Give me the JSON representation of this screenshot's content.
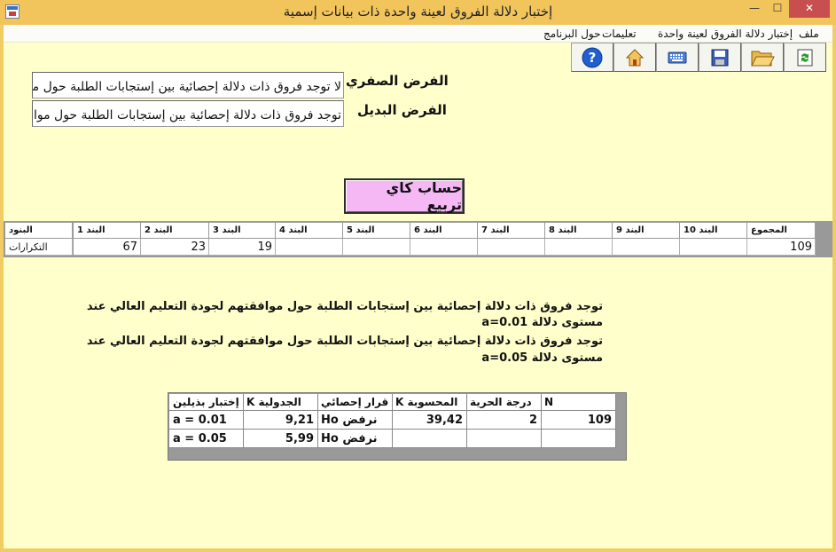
{
  "window": {
    "title": "إختبار دلالة الفروق لعينة واحدة ذات بيانات إسمية",
    "minimize_glyph": "—",
    "maximize_glyph": "☐",
    "close_glyph": "✕"
  },
  "menu": {
    "file": "ملف",
    "test": "إختبار دلالة الفروق لعينة واحدة",
    "instructions": "تعليمات",
    "about": "حول البرنامج"
  },
  "toolbar": {
    "icons": [
      "refresh-icon",
      "folder-open-icon",
      "save-icon",
      "keyboard-icon",
      "home-icon",
      "help-icon"
    ]
  },
  "hypotheses": {
    "null_label": "الفرض الصفري",
    "null_value": "لا توجد فروق ذات دلالة إحصائية بين إستجابات الطلبة حول موافقتهم",
    "alt_label": "الفرض البديل",
    "alt_value": "توجد فروق ذات دلالة إحصائية بين إستجابات الطلبة حول موافقتهم لـ"
  },
  "calculate_button": "حساب كاي تربيع",
  "frequency_grid": {
    "headers": [
      "البنود",
      "البند 1",
      "البند 2",
      "البند 3",
      "البند 4",
      "البند 5",
      "البند 6",
      "البند 7",
      "البند 8",
      "البند 9",
      "البند 10",
      "المجموع"
    ],
    "row_label": "التكرارات",
    "values": [
      "67",
      "23",
      "19",
      "",
      "",
      "",
      "",
      "",
      "",
      "",
      "109"
    ]
  },
  "results_text": {
    "line1a": "توجد فروق ذات دلالة إحصائية بين إستجابات الطلبة حول موافقتهم لجودة التعليم العالي عند",
    "line1b": "مستوى دلالة a=0.01",
    "line2a": "توجد فروق ذات دلالة إحصائية بين إستجابات الطلبة حول موافقتهم لجودة التعليم العالي عند",
    "line2b": "مستوى دلالة a=0.05"
  },
  "results_table": {
    "headers": [
      "إختبار بذيلين",
      "K الجدولية",
      "قرار إحصائي",
      "K المحسوبة",
      "درجة الحرية",
      "N"
    ],
    "rows": [
      [
        "a = 0.01",
        "9,21",
        "Ho نرفض",
        "39,42",
        "2",
        "109"
      ],
      [
        "a = 0.05",
        "5,99",
        "Ho نرفض",
        "",
        "",
        ""
      ]
    ]
  }
}
